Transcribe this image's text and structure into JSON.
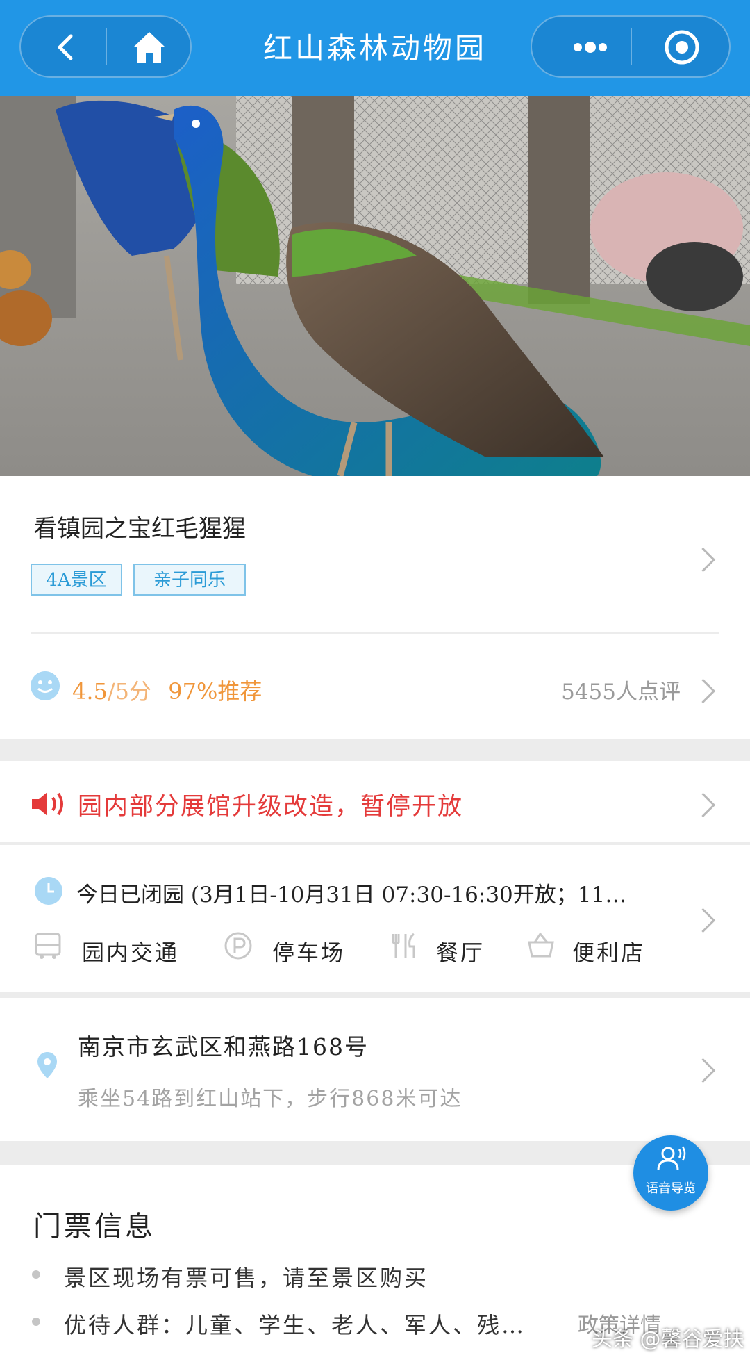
{
  "header": {
    "title": "红山森林动物园"
  },
  "hero": {
    "alt": ""
  },
  "attraction": {
    "name": "看镇园之宝红毛猩猩",
    "tags": [
      "4A景区",
      "亲子同乐"
    ],
    "rating_score": "4.5",
    "rating_max": "/5分",
    "recommend": "97%推荐",
    "review_count": "5455人点评"
  },
  "notice": {
    "text": "园内部分展馆升级改造，暂停开放"
  },
  "hours": {
    "text": "今日已闭园 (3月1日-10月31日 07:30-16:30开放；11…"
  },
  "facilities": [
    {
      "label": "园内交通",
      "icon": "bus-icon"
    },
    {
      "label": "停车场",
      "icon": "parking-icon"
    },
    {
      "label": "餐厅",
      "icon": "restaurant-icon"
    },
    {
      "label": "便利店",
      "icon": "basket-icon"
    }
  ],
  "location": {
    "address": "南京市玄武区和燕路168号",
    "route": "乘坐54路到红山站下，步行868米可达"
  },
  "tickets": {
    "title": "门票信息",
    "items": [
      "景区现场有票可售，请至景区购买",
      "优待人群：儿童、学生、老人、军人、残…"
    ],
    "policy_link": "政策详情"
  },
  "voice_guide": {
    "label": "语音导览"
  },
  "watermark": "头条 @馨谷爱扶",
  "colors": {
    "accent": "#2196e6",
    "notice_red": "#e43a3a",
    "rating_orange": "#f0963a"
  }
}
